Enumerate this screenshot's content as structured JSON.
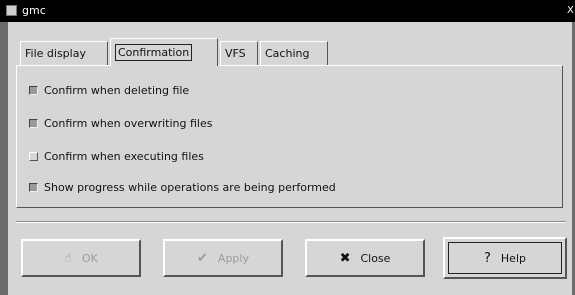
{
  "window": {
    "title": "gmc",
    "close_glyph": "X"
  },
  "tabs": [
    {
      "label": "File display",
      "active": false
    },
    {
      "label": "Confirmation",
      "active": true
    },
    {
      "label": "VFS",
      "active": false
    },
    {
      "label": "Caching",
      "active": false
    }
  ],
  "options": [
    {
      "label": "Confirm when deleting file",
      "checked": true
    },
    {
      "label": "Confirm when overwriting files",
      "checked": true
    },
    {
      "label": "Confirm when executing files",
      "checked": false
    },
    {
      "label": "Show progress while operations are being performed",
      "checked": true
    }
  ],
  "buttons": {
    "ok": {
      "label": "OK",
      "icon": "ok-icon",
      "glyph": "☝",
      "enabled": false
    },
    "apply": {
      "label": "Apply",
      "icon": "checkmark-icon",
      "glyph": "✔",
      "enabled": false
    },
    "close": {
      "label": "Close",
      "icon": "close-x-icon",
      "glyph": "✖",
      "enabled": true
    },
    "help": {
      "label": "Help",
      "icon": "question-icon",
      "glyph": "?",
      "enabled": true
    }
  }
}
